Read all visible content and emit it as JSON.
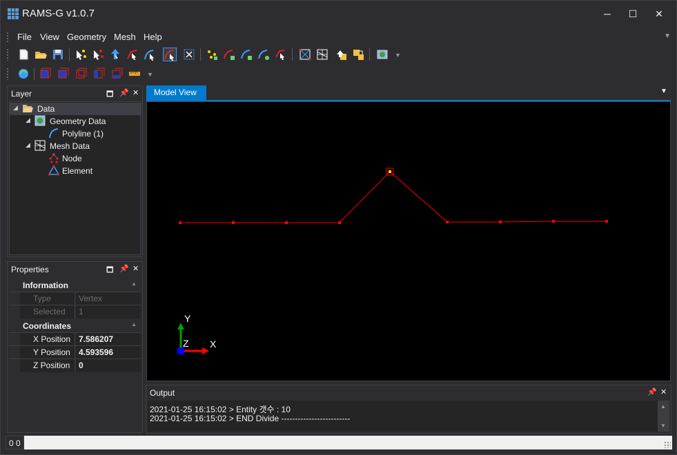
{
  "window": {
    "title": "RAMS-G v1.0.7",
    "minimize": "─",
    "maximize": "☐",
    "close": "✕"
  },
  "menu": [
    "File",
    "View",
    "Geometry",
    "Mesh",
    "Help"
  ],
  "layer_panel": {
    "title": "Layer",
    "tree": [
      {
        "label": "Data",
        "icon": "folder-open-icon",
        "expanded": true
      },
      {
        "label": "Geometry Data",
        "icon": "geometry-map-icon",
        "expanded": true
      },
      {
        "label": "Polyline (1)",
        "icon": "polyline-icon"
      },
      {
        "label": "Mesh Data",
        "icon": "mesh-grid-icon",
        "expanded": true
      },
      {
        "label": "Node",
        "icon": "node-icon"
      },
      {
        "label": "Element",
        "icon": "element-triangle-icon"
      }
    ]
  },
  "properties_panel": {
    "title": "Properties",
    "categories": [
      {
        "name": "Information",
        "rows": [
          {
            "name": "Type",
            "value": "Vertex"
          },
          {
            "name": "Selected",
            "value": "1"
          }
        ]
      },
      {
        "name": "Coordinates",
        "rows": [
          {
            "name": "X Position",
            "value": "7.586207"
          },
          {
            "name": "Y Position",
            "value": "4.593596"
          },
          {
            "name": "Z Position",
            "value": "0"
          }
        ]
      }
    ]
  },
  "model_view": {
    "tab_label": "Model View",
    "axis_labels": {
      "x": "X",
      "y": "Y",
      "z": "Z"
    },
    "line_color": "#ff0000",
    "axis_colors": {
      "x": "#ff0000",
      "y": "#00a000",
      "z": "#0000ff"
    }
  },
  "output_panel": {
    "title": "Output",
    "lines": [
      "2021-01-25 16:15:02 > Entity 갯수 : 10",
      "2021-01-25 16:15:02 > END Divide -------------------------"
    ]
  },
  "statusbar": {
    "coords": "0 0"
  },
  "colors": {
    "accent": "#007acc",
    "background": "#2d2d30",
    "panel": "#252526"
  }
}
